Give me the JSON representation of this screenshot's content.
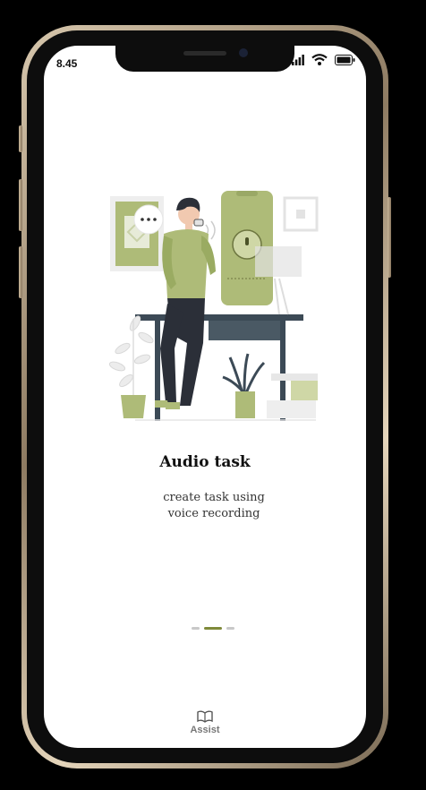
{
  "status_bar": {
    "time": "8.45"
  },
  "onboarding": {
    "title": "Audio task",
    "subtitle": "create task using voice recording",
    "page_indicator": {
      "total": 3,
      "active_index": 1
    }
  },
  "bottom_nav": {
    "items": [
      {
        "label": "Assist",
        "icon": "book-icon"
      }
    ]
  },
  "colors": {
    "accent": "#7f8a3a",
    "illustration_green": "#aebb78"
  }
}
